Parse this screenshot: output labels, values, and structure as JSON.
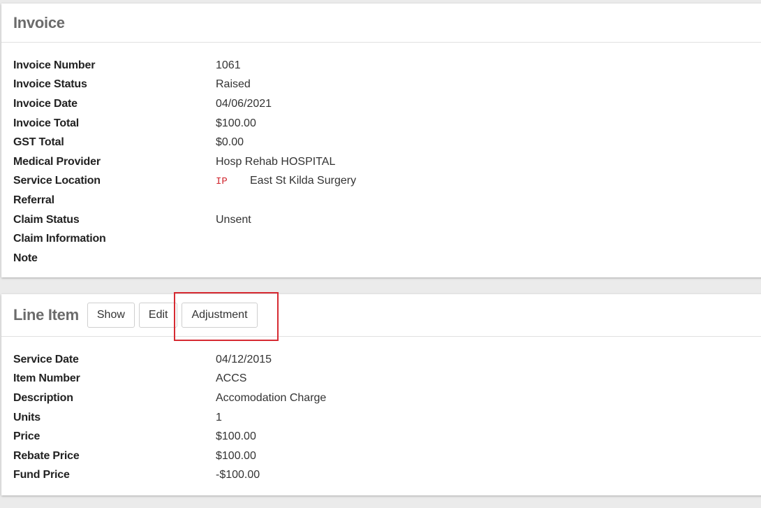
{
  "invoice": {
    "title": "Invoice",
    "fields": [
      {
        "label": "Invoice Number",
        "value": "1061"
      },
      {
        "label": "Invoice Status",
        "value": "Raised"
      },
      {
        "label": "Invoice Date",
        "value": "04/06/2021"
      },
      {
        "label": "Invoice Total",
        "value": "$100.00"
      },
      {
        "label": "GST Total",
        "value": "$0.00"
      },
      {
        "label": "Medical Provider",
        "value": "Hosp Rehab HOSPITAL"
      },
      {
        "label": "Service Location",
        "code": "IP",
        "value": "East St Kilda Surgery"
      },
      {
        "label": "Referral",
        "value": ""
      },
      {
        "label": "Claim Status",
        "value": "Unsent"
      },
      {
        "label": "Claim Information",
        "value": ""
      },
      {
        "label": "Note",
        "value": ""
      }
    ]
  },
  "line_item": {
    "title": "Line Item",
    "buttons": {
      "show": "Show",
      "edit": "Edit",
      "adjustment": "Adjustment"
    },
    "fields": [
      {
        "label": "Service Date",
        "value": "04/12/2015"
      },
      {
        "label": "Item Number",
        "value": "ACCS"
      },
      {
        "label": "Description",
        "value": "Accomodation Charge"
      },
      {
        "label": "Units",
        "value": "1"
      },
      {
        "label": "Price",
        "value": "$100.00"
      },
      {
        "label": "Rebate Price",
        "value": "$100.00"
      },
      {
        "label": "Fund Price",
        "value": "-$100.00"
      }
    ]
  },
  "colors": {
    "highlight": "#d62a32",
    "code_text": "#d0242d",
    "title_text": "#6b6b6b"
  }
}
